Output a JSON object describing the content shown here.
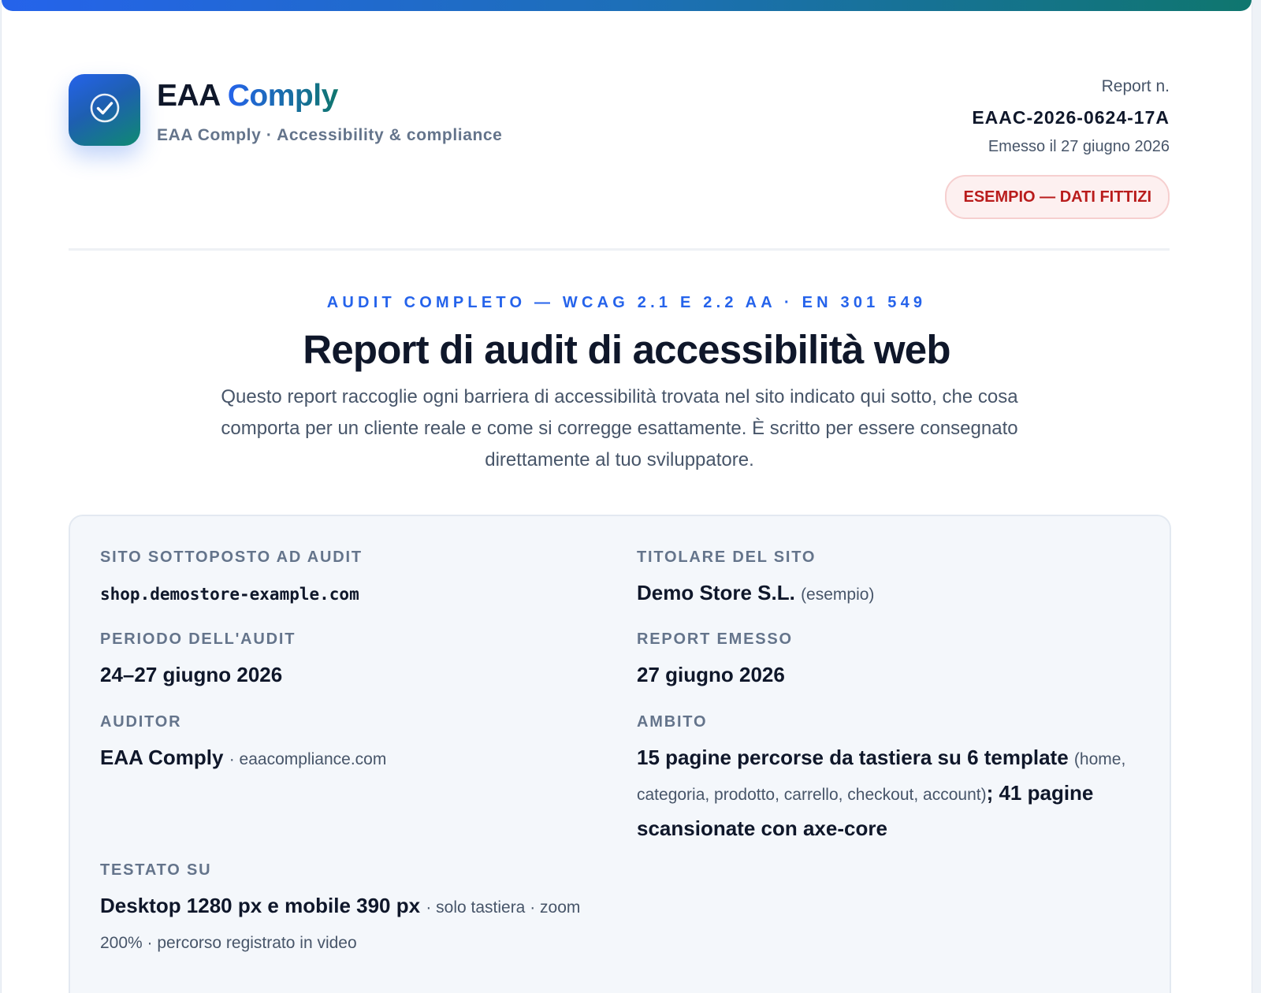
{
  "brand": {
    "name_main": "EAA",
    "name_accent": "Comply",
    "tagline": "EAA Comply · Accessibility & compliance",
    "logo_icon": "check-circle-icon",
    "colors": {
      "primary": "#2563eb",
      "secondary": "#0f766e"
    }
  },
  "report": {
    "number_label": "Report n.",
    "number": "EAAC-2026-0624-17A",
    "issued": "Emesso il 27 giugno 2026",
    "badge": "ESEMPIO — DATI FITTIZI",
    "badge_color": "#b91c1c"
  },
  "hero": {
    "kicker": "AUDIT COMPLETO — WCAG 2.1 E 2.2 AA · EN 301 549",
    "title": "Report di audit di accessibilità web",
    "intro": "Questo report raccoglie ogni barriera di accessibilità trovata nel sito indicato qui sotto, che cosa comporta per un cliente reale e come si corregge esattamente. È scritto per essere consegnato direttamente al tuo sviluppatore."
  },
  "details": {
    "site": {
      "label": "SITO SOTTOPOSTO AD AUDIT",
      "value": "shop.demostore-example.com"
    },
    "owner": {
      "label": "TITOLARE DEL SITO",
      "value": "Demo Store S.L.",
      "note": "(esempio)"
    },
    "period": {
      "label": "PERIODO DELL'AUDIT",
      "value": "24–27 giugno 2026"
    },
    "issued": {
      "label": "REPORT EMESSO",
      "value": "27 giugno 2026"
    },
    "auditor": {
      "label": "AUDITOR",
      "value": "EAA Comply",
      "note": "· eaacompliance.com"
    },
    "scope": {
      "label": "AMBITO",
      "value_a": "15 pagine percorse da tastiera su 6 template",
      "note": "(home, categoria, prodotto, carrello, checkout, account)",
      "value_b": "; 41 pagine scansionate con axe-core"
    },
    "tested": {
      "label": "TESTATO SU",
      "value": "Desktop 1280 px e mobile 390 px",
      "note": "· solo tastiera · zoom 200% · percorso registrato in video"
    }
  }
}
